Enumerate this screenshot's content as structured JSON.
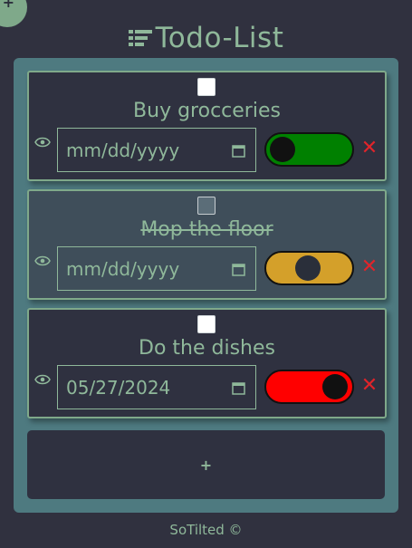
{
  "app": {
    "title": "Todo-List",
    "footer": "SoTilted ©",
    "add_corner": "+",
    "add_task": "+"
  },
  "colors": {
    "background": "#30313f",
    "board": "#4e7a80",
    "accent": "#8fb89a",
    "delete": "#e0242a"
  },
  "tasks": [
    {
      "text": "Buy grocceries",
      "completed": false,
      "date": "mm/dd/yyyy",
      "toggle_color": "#008000",
      "toggle_state": "left",
      "delete": "✕"
    },
    {
      "text": "Mop the floor",
      "completed": true,
      "date": "mm/dd/yyyy",
      "toggle_color": "#d4a02a",
      "toggle_state": "middle",
      "delete": "✕"
    },
    {
      "text": "Do the dishes",
      "completed": false,
      "date": "05/27/2024",
      "toggle_color": "#ff0000",
      "toggle_state": "right",
      "delete": "✕"
    }
  ]
}
